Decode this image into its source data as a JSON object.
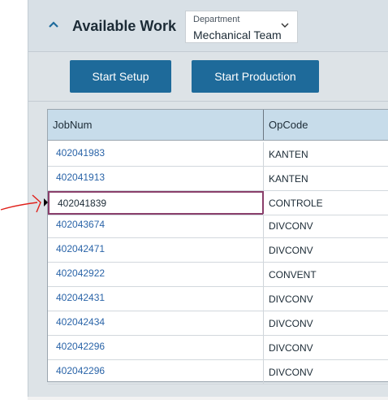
{
  "panel": {
    "title": "Available Work",
    "department": {
      "label": "Department",
      "value": "Mechanical Team"
    }
  },
  "actions": {
    "start_setup": "Start Setup",
    "start_production": "Start Production"
  },
  "grid": {
    "columns": [
      "JobNum",
      "OpCode"
    ],
    "rows": [
      {
        "job": "402041983",
        "op": "KANTEN"
      },
      {
        "job": "402041913",
        "op": "KANTEN"
      },
      {
        "job": "402041839",
        "op": "CONTROLE"
      },
      {
        "job": "402043674",
        "op": "DIVCONV"
      },
      {
        "job": "402042471",
        "op": "DIVCONV"
      },
      {
        "job": "402042922",
        "op": "CONVENT"
      },
      {
        "job": "402042431",
        "op": "DIVCONV"
      },
      {
        "job": "402042434",
        "op": "DIVCONV"
      },
      {
        "job": "402042296",
        "op": "DIVCONV"
      },
      {
        "job": "402042296",
        "op": "DIVCONV"
      }
    ],
    "selected_index": 2
  },
  "colors": {
    "header_bg": "#d8e0e6",
    "button_bg": "#1e6a9a",
    "grid_head_bg": "#c7dcea",
    "link_text": "#2a64a8",
    "selected_border": "#8a3f6b",
    "annotation_arrow": "#e0201a"
  },
  "icons": {
    "collapse": "chevron-up-icon",
    "dropdown": "chevron-down-icon",
    "row_indicator": "triangle-right-icon"
  }
}
